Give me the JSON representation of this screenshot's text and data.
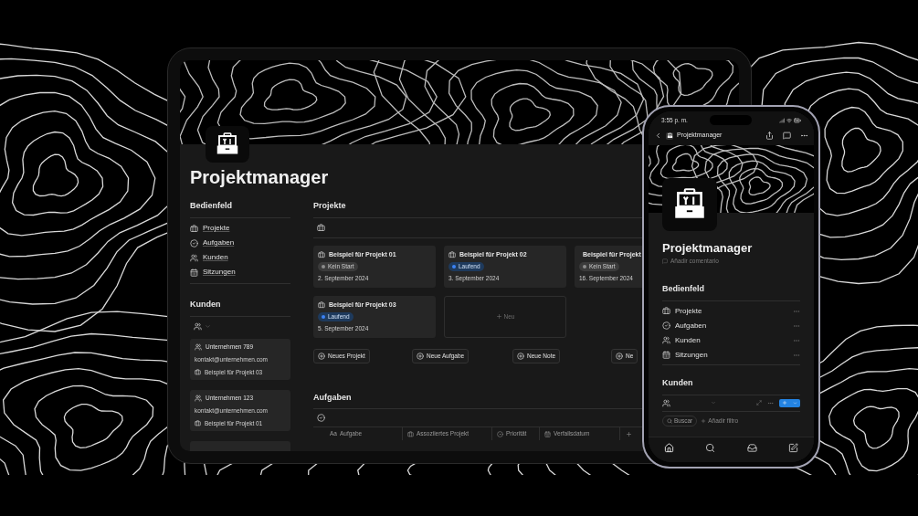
{
  "tablet": {
    "title": "Projektmanager",
    "dashboard": {
      "heading": "Bedienfeld",
      "items": [
        {
          "label": "Projekte"
        },
        {
          "label": "Aufgaben"
        },
        {
          "label": "Kunden"
        },
        {
          "label": "Sitzungen"
        }
      ]
    },
    "clients": {
      "heading": "Kunden",
      "cards": [
        {
          "name": "Unternehmen 789",
          "email": "kontakt@unternehmen.com",
          "project": "Beispiel für Projekt 03"
        },
        {
          "name": "Unternehmen 123",
          "email": "kontakt@unternehmen.com",
          "project": "Beispiel für Projekt 01"
        }
      ]
    },
    "projects": {
      "heading": "Projekte",
      "cards": [
        {
          "title": "Beispiel für Projekt 01",
          "status": {
            "label": "Kein Start",
            "kind": "not-started",
            "color": "#8c8c8c"
          },
          "date": "2. September 2024"
        },
        {
          "title": "Beispiel für Projekt 02",
          "status": {
            "label": "Laufend",
            "kind": "in-progress",
            "color": "#3b82f6"
          },
          "date": "3. September 2024"
        },
        {
          "title": "Beispiel für Projekt",
          "status": {
            "label": "Kein Start",
            "kind": "not-started",
            "color": "#8c8c8c"
          },
          "date": "16. September 2024"
        },
        {
          "title": "Beispiel für Projekt 03",
          "status": {
            "label": "Laufend",
            "kind": "in-progress",
            "color": "#3b82f6"
          },
          "date": "5. September 2024"
        }
      ],
      "new_card": "Neu",
      "buttons": [
        "Neues Projekt",
        "Neue Aufgabe",
        "Neue Note",
        "Ne"
      ]
    },
    "tasks": {
      "heading": "Aufgaben",
      "columns": [
        {
          "glyph": "Aa",
          "label": "Aufgabe"
        },
        {
          "label": "Assoziiertes Projekt"
        },
        {
          "label": "Priorität"
        },
        {
          "label": "Verfallsdatum"
        }
      ]
    }
  },
  "phone": {
    "time": "3:55 p. m.",
    "nav_title": "Projektmanager",
    "title": "Projektmanager",
    "comment": "Añadir comentario",
    "dashboard": {
      "heading": "Bedienfeld",
      "items": [
        {
          "label": "Projekte"
        },
        {
          "label": "Aufgaben"
        },
        {
          "label": "Kunden"
        },
        {
          "label": "Sitzungen"
        }
      ]
    },
    "clients": {
      "heading": "Kunden"
    },
    "search": "Buscar",
    "add_filter": "Añadir filtro"
  }
}
